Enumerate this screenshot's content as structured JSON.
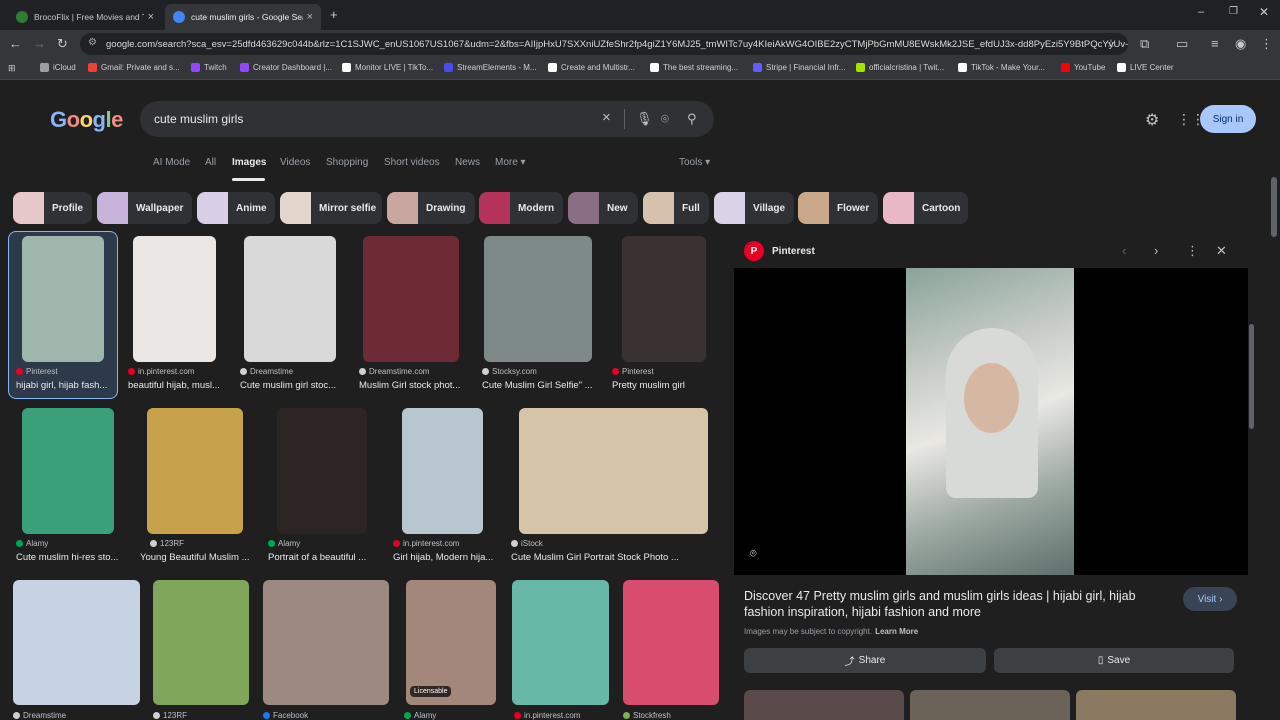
{
  "browser": {
    "tabs": [
      {
        "title": "BrocoFlix | Free Movies and TV",
        "active": false,
        "color": "#2e7d32"
      },
      {
        "title": "cute muslim girls - Google Sea",
        "active": true,
        "color": "#4285f4"
      }
    ],
    "new_tab": "+",
    "url": "google.com/search?sca_esv=25dfd463629c044b&rlz=1C1SJWC_enUS1067US1067&udm=2&fbs=AIIjpHxU7SXXniUZfeShr2fp4giZ1Y6MJ25_tmWITc7uy4KIeiAkWG4OIBE2zyCTMjPbGmMU8EWskMk2JSE_efdUJ3x-dd8PyEzi5Y9BtPQcYyUv-qqG...",
    "bookmarks": [
      {
        "label": "iCloud",
        "color": "#9e9e9e"
      },
      {
        "label": "Gmail: Private and s...",
        "color": "#ea4335"
      },
      {
        "label": "Twitch",
        "color": "#9146ff"
      },
      {
        "label": "Creator Dashboard |...",
        "color": "#9146ff"
      },
      {
        "label": "Monitor LIVE | TikTo...",
        "color": "#ffffff"
      },
      {
        "label": "StreamElements - M...",
        "color": "#4b4bf2"
      },
      {
        "label": "Create and Multistr...",
        "color": "#ffffff"
      },
      {
        "label": "The best streaming...",
        "color": "#ffffff"
      },
      {
        "label": "Stripe | Financial Infr...",
        "color": "#635bff"
      },
      {
        "label": "officialcristina | Twit...",
        "color": "#a4e400"
      },
      {
        "label": "TikTok - Make Your...",
        "color": "#ffffff"
      },
      {
        "label": "YouTube",
        "color": "#ff0000"
      },
      {
        "label": "LIVE Center",
        "color": "#ffffff"
      }
    ]
  },
  "google": {
    "logo": "Google",
    "query": "cute muslim girls",
    "sign_in": "Sign in",
    "nav_tabs": [
      "AI Mode",
      "All",
      "Images",
      "Videos",
      "Shopping",
      "Short videos",
      "News",
      "More ▾"
    ],
    "tools": "Tools ▾",
    "chips": [
      {
        "label": "Profile",
        "color": "#e6c8c8"
      },
      {
        "label": "Wallpaper",
        "color": "#c7b3d9"
      },
      {
        "label": "Anime",
        "color": "#d8cfe6"
      },
      {
        "label": "Mirror selfie",
        "color": "#e2d6cc"
      },
      {
        "label": "Drawing",
        "color": "#c9a6a0"
      },
      {
        "label": "Modern",
        "color": "#b5335a"
      },
      {
        "label": "New",
        "color": "#8a6f84"
      },
      {
        "label": "Full",
        "color": "#d6c0ae"
      },
      {
        "label": "Village",
        "color": "#d9d3e8"
      },
      {
        "label": "Flower",
        "color": "#caa98a"
      },
      {
        "label": "Cartoon",
        "color": "#e8b8c6"
      }
    ]
  },
  "results": [
    {
      "source": "Pinterest",
      "title": "hijabi girl, hijab fash...",
      "icon_color": "#e60023",
      "img_color": "#9fb6ad"
    },
    {
      "source": "in.pinterest.com",
      "title": "beautiful hijab, musl...",
      "icon_color": "#e60023",
      "img_color": "#e9e6e4"
    },
    {
      "source": "Dreamstime",
      "title": "Cute muslim girl stoc...",
      "icon_color": "#cfcfcf",
      "img_color": "#d9d9d9"
    },
    {
      "source": "Dreamstime.com",
      "title": "Muslim Girl stock phot...",
      "icon_color": "#cfcfcf",
      "img_color": "#6e2a35"
    },
    {
      "source": "Stocksy.com",
      "title": "Cute Muslim Girl Selfie\" ...",
      "icon_color": "#cfcfcf",
      "img_color": "#7e8a88"
    },
    {
      "source": "Pinterest",
      "title": "Pretty muslim girl",
      "icon_color": "#e60023",
      "img_color": "#3a3230"
    },
    {
      "source": "Alamy",
      "title": "Cute muslim hi-res sto...",
      "icon_color": "#00a651",
      "img_color": "#3aa07a"
    },
    {
      "source": "123RF",
      "title": "Young Beautiful Muslim ...",
      "icon_color": "#cfcfcf",
      "img_color": "#c8a24a"
    },
    {
      "source": "Alamy",
      "title": "Portrait of a beautiful ...",
      "icon_color": "#00a651",
      "img_color": "#2c2523"
    },
    {
      "source": "in.pinterest.com",
      "title": "Girl hijab, Modern hija...",
      "icon_color": "#e60023",
      "img_color": "#b8c7cf"
    },
    {
      "source": "iStock",
      "title": "Cute Muslim Girl Portrait Stock Photo ...",
      "icon_color": "#cfcfcf",
      "img_color": "#d6c4a8"
    },
    {
      "source": "Dreamstime",
      "title": "",
      "icon_color": "#cfcfcf",
      "img_color": "#c5d3e2"
    },
    {
      "source": "123RF",
      "title": "",
      "icon_color": "#cfcfcf",
      "img_color": "#7fa65a"
    },
    {
      "source": "Facebook",
      "title": "",
      "icon_color": "#1877f2",
      "img_color": "#9c8a80"
    },
    {
      "source": "Alamy",
      "title": "",
      "icon_color": "#00a651",
      "img_color": "#a4877b",
      "badge": "Licensable"
    },
    {
      "source": "in.pinterest.com",
      "title": "",
      "icon_color": "#e60023",
      "img_color": "#67b8a6"
    },
    {
      "source": "Stockfresh",
      "title": "",
      "icon_color": "#7cb342",
      "img_color": "#d84d6e"
    }
  ],
  "preview": {
    "source": "Pinterest",
    "title": "Discover 47 Pretty muslim girls and muslim girls ideas | hijabi girl, hijab fashion inspiration, hijabi fashion and more",
    "visit": "Visit ›",
    "copyright": "Images may be subject to copyright.",
    "learn_more": "Learn More",
    "share": "Share",
    "save": "Save"
  }
}
